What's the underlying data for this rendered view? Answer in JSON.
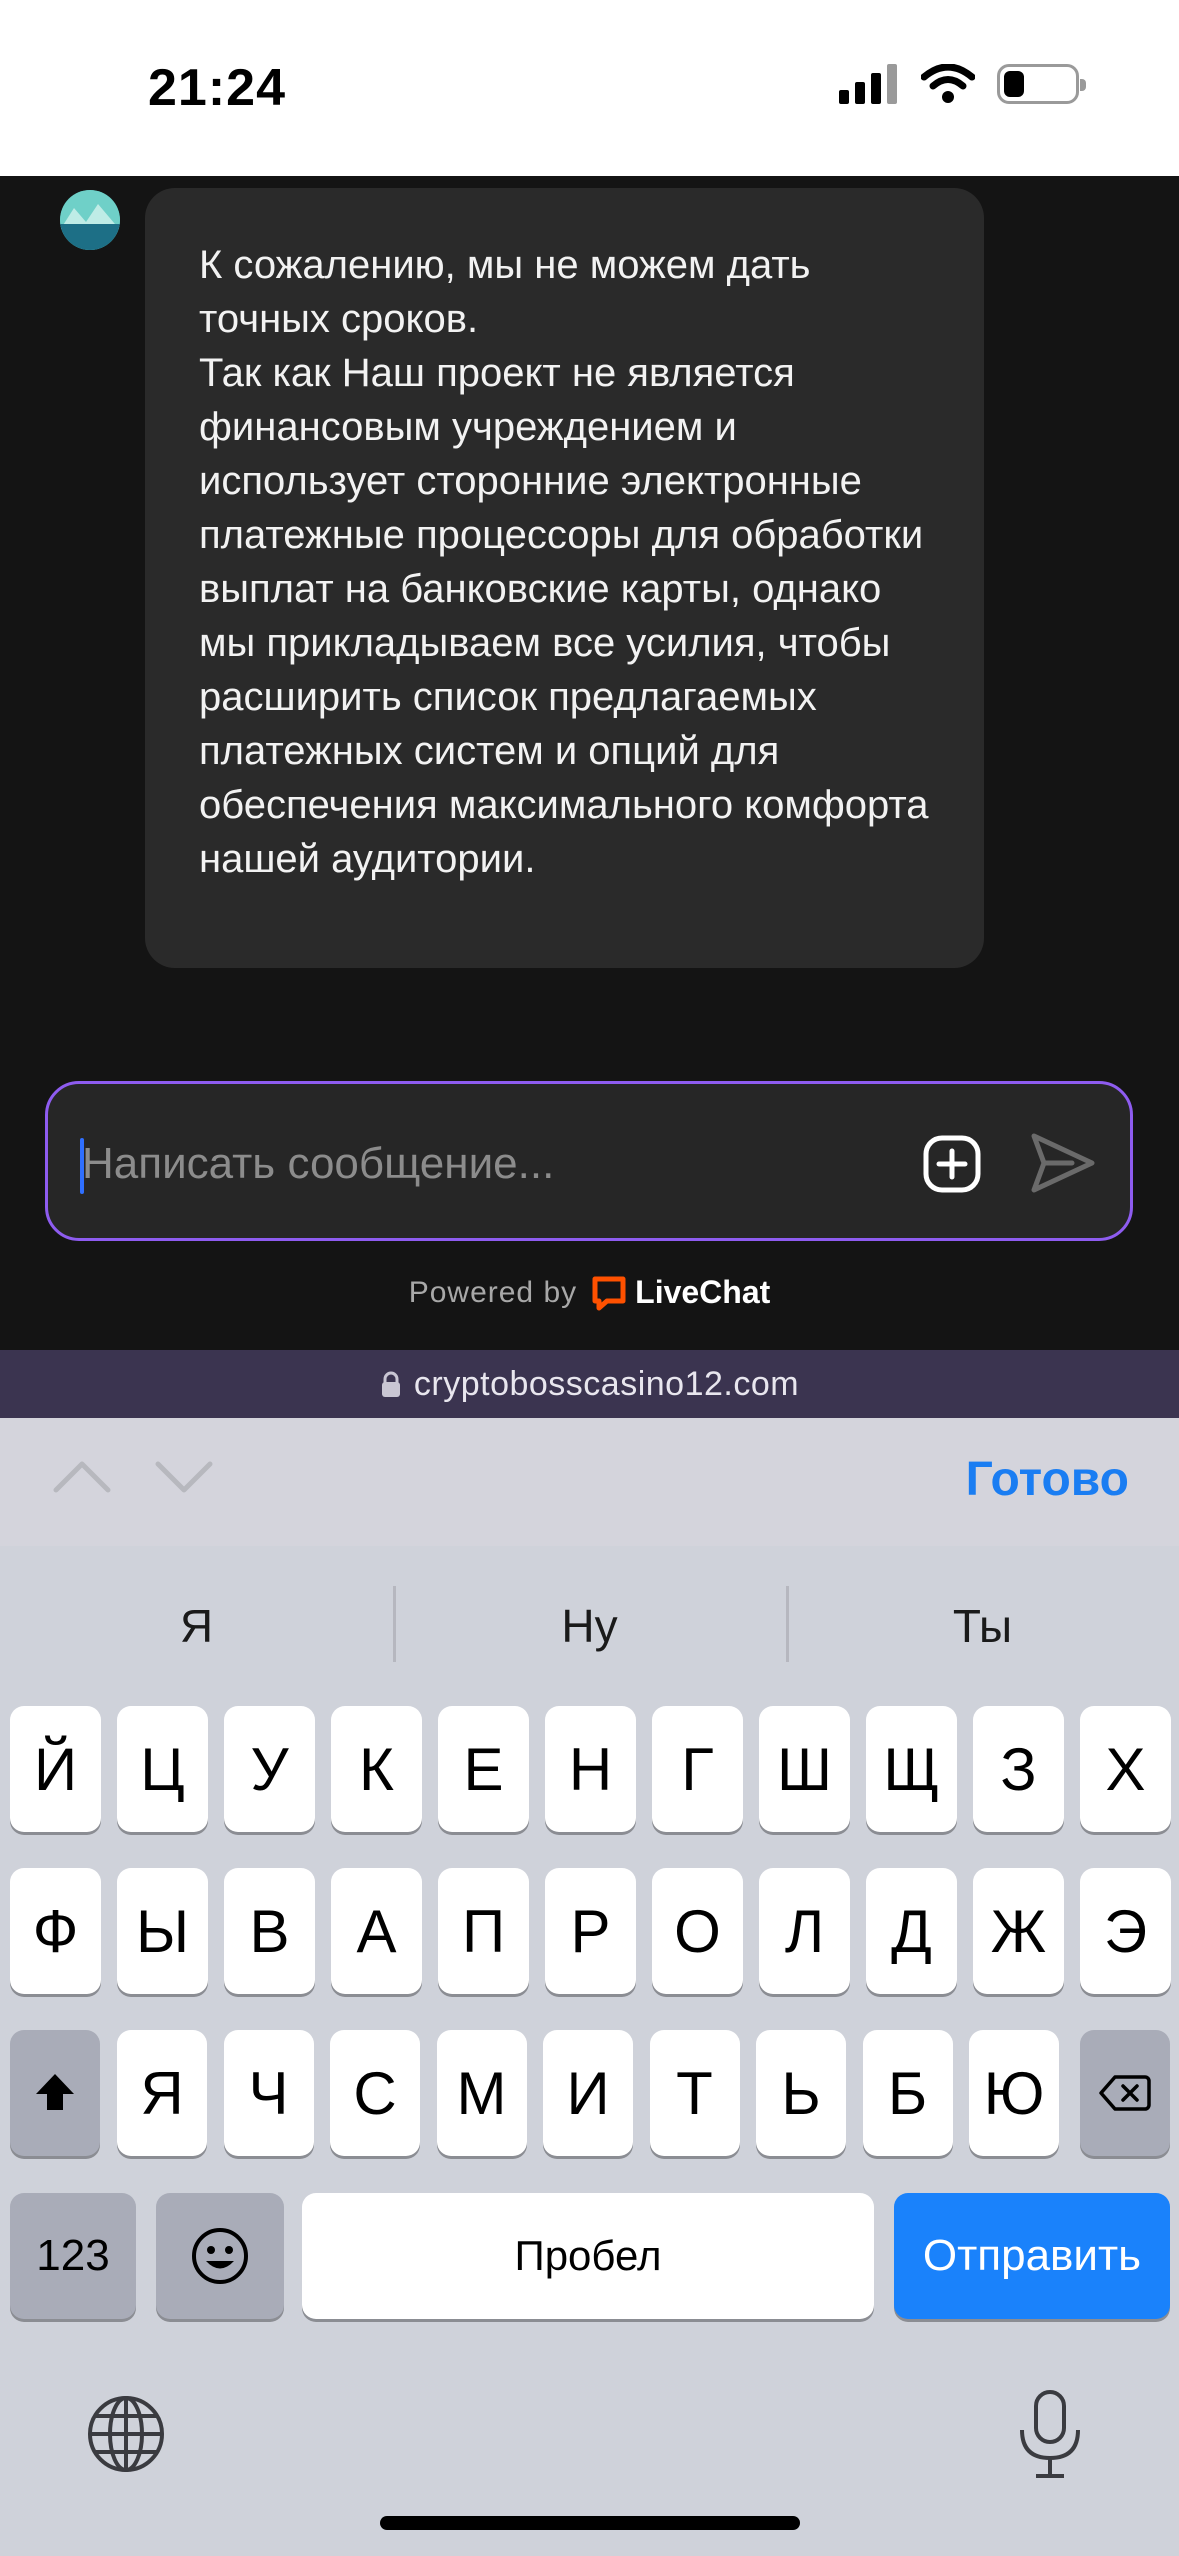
{
  "status_bar": {
    "time": "21:24",
    "icons": [
      "cellular-signal-icon",
      "wifi-icon",
      "battery-icon"
    ]
  },
  "chat": {
    "agent_avatar_icon": "mountain-avatar-icon",
    "messages": [
      {
        "sender": "agent",
        "text": "К сожалению, мы не можем дать точных сроков.\nТак как Наш проект не является финансовым учреждением и использует сторонние электронные платежные процессоры для обработки выплат на банковские карты, однако мы прикладываем все усилия, чтобы расширить список предлагаемых платежных систем и опций для обеспечения максимального комфорта нашей аудитории."
      }
    ],
    "composer": {
      "placeholder": "Написать сообщение...",
      "value": "",
      "attach_icon": "plus-square-icon",
      "send_icon": "send-icon"
    },
    "powered_by": "Powered by",
    "brand": "LiveChat",
    "accent_color": "#8e5cf0"
  },
  "browser": {
    "url": "cryptobosscasino12.com",
    "lock_icon": "lock-icon"
  },
  "keyboard": {
    "accessory": {
      "prev_icon": "chevron-up-icon",
      "next_icon": "chevron-down-icon",
      "done_label": "Готово"
    },
    "suggestions": [
      "Я",
      "Ну",
      "Ты"
    ],
    "rows": [
      [
        "Й",
        "Ц",
        "У",
        "К",
        "Е",
        "Н",
        "Г",
        "Ш",
        "Щ",
        "З",
        "Х"
      ],
      [
        "Ф",
        "Ы",
        "В",
        "А",
        "П",
        "Р",
        "О",
        "Л",
        "Д",
        "Ж",
        "Э"
      ],
      [
        "Я",
        "Ч",
        "С",
        "М",
        "И",
        "Т",
        "Ь",
        "Б",
        "Ю"
      ]
    ],
    "shift_icon": "shift-icon",
    "delete_icon": "delete-icon",
    "numbers_label": "123",
    "emoji_icon": "emoji-icon",
    "space_label": "Пробел",
    "send_label": "Отправить",
    "globe_icon": "globe-icon",
    "mic_icon": "microphone-icon"
  }
}
